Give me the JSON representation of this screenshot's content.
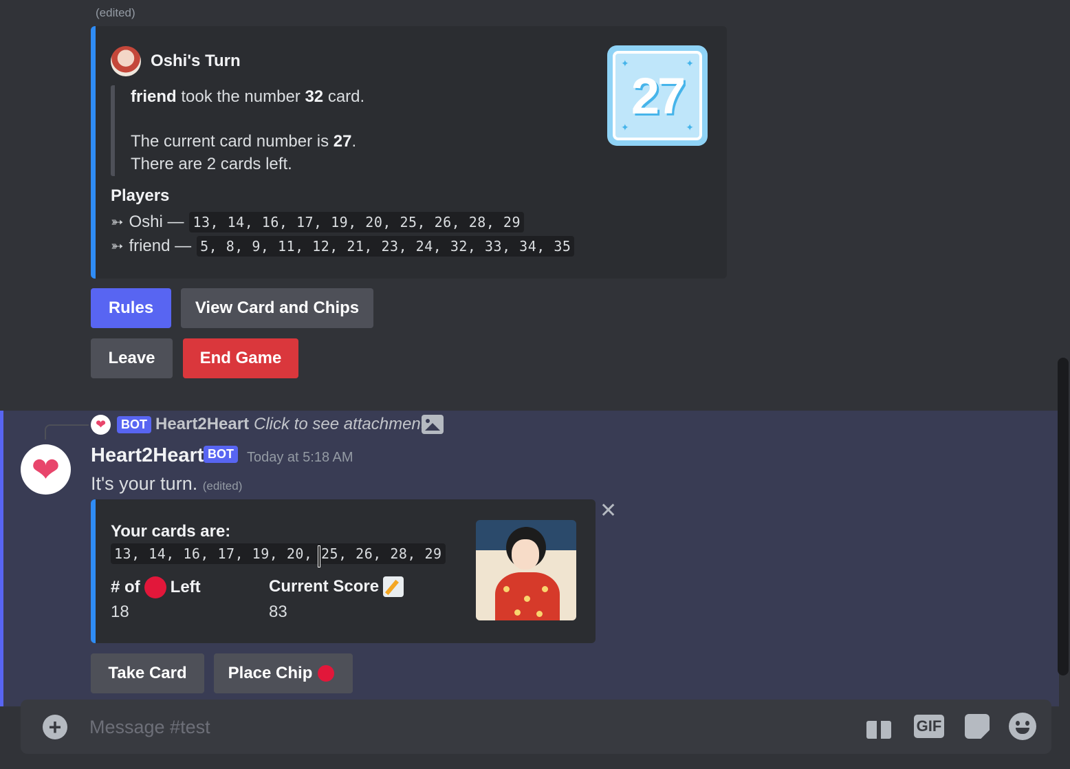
{
  "first_message": {
    "edited_label": "(edited)",
    "embed": {
      "author": "Oshi's Turn",
      "line1_bold_name": "friend",
      "line1_text": "took the number",
      "line1_number": "32",
      "line1_end": "card.",
      "line2_text": "The current card number is",
      "line2_number": "27",
      "line2_end": ".",
      "line3_text": "There are 2 cards left.",
      "players_title": "Players",
      "players": [
        {
          "arrow": "➳",
          "name": "Oshi —",
          "cards": "13, 14, 16, 17, 19, 20, 25, 26, 28, 29"
        },
        {
          "arrow": "➳",
          "name": "friend —",
          "cards": "5, 8, 9, 11, 12, 21, 23, 24, 32, 33, 34, 35"
        }
      ],
      "thumbnail_number": "27",
      "accent_color": "#2f8cf5"
    },
    "buttons": {
      "rules": "Rules",
      "view_card": "View Card and Chips",
      "leave": "Leave",
      "end_game": "End Game"
    }
  },
  "second_message": {
    "reply": {
      "bot_tag": "BOT",
      "name": "Heart2Heart",
      "text": "Click to see attachment"
    },
    "username": "Heart2Heart",
    "bot_tag": "BOT",
    "timestamp": "Today at 5:18 AM",
    "content": "It's your turn.",
    "edited_label": "(edited)",
    "embed": {
      "cards_title": "Your cards are:",
      "cards": "13, 14, 16, 17, 19, 20, 25, 26, 28, 29",
      "field1_prefix": "# of",
      "field1_suffix": "Left",
      "field1_value": "18",
      "field2_name": "Current Score",
      "field2_value": "83",
      "accent_color": "#2f8cf5"
    },
    "buttons": {
      "take_card": "Take Card",
      "place_chip": "Place Chip"
    }
  },
  "composer": {
    "placeholder": "Message #test",
    "gif_label": "GIF"
  },
  "colors": {
    "background": "#313338",
    "highlight": "#393c54",
    "blurple": "#5865f2",
    "danger": "#da373c",
    "secondary": "#4e5058",
    "chip_red": "#e2173a"
  }
}
